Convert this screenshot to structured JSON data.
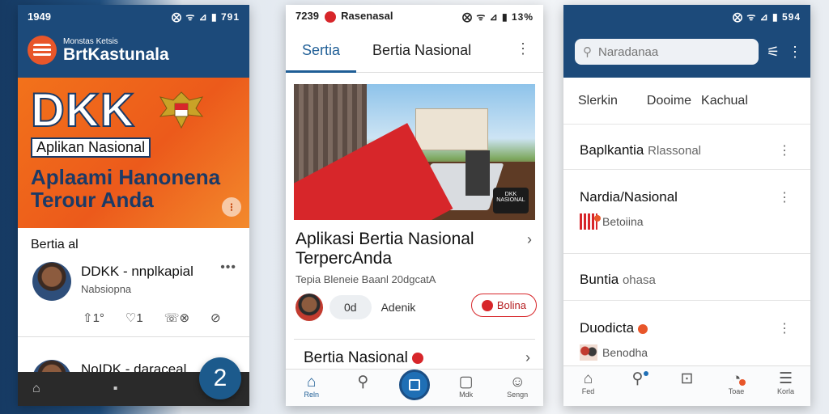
{
  "phone1": {
    "status": {
      "time": "1949",
      "icons": "⨂ ᯤ ⊿ ▮ 791"
    },
    "brand": {
      "small": "Monstas Ketsis",
      "name": "BrtKastunala"
    },
    "hero": {
      "logo_text": "DKK",
      "tagline": "Aplikan Nasional",
      "headline_1": "Aplaami Hanonena",
      "headline_2": "Terour Anda",
      "info_icon": "info-icon"
    },
    "section_title": "Bertia al",
    "post": {
      "title": "DDKK - nnplkapial",
      "subtitle": "Nabsiopna",
      "more": "•••",
      "actions": {
        "like": "⇧1°",
        "comment": "♡1",
        "share": "☏⊗",
        "reply": "⊘"
      }
    },
    "post2": {
      "title": "NoIDK - daraceal"
    },
    "fab_label": "2"
  },
  "phone2": {
    "status": {
      "time": "7239",
      "app": "Rasenasal",
      "icons": "⨂ ᯤ ⊿ ▮ 13%"
    },
    "tabs": [
      {
        "label": "Sertia"
      },
      {
        "label": "Bertia Nasional"
      }
    ],
    "image_badge": "DKK NASIONAL",
    "headline": "Aplikasi Bertia Nasional TerpercAnda",
    "meta": "Tepia Bleneie Baanl 20dgcatA",
    "actions": {
      "count": "0d",
      "author": "Adenik",
      "button": "Bolina"
    },
    "headline2": "Bertia Nasional",
    "nav": [
      {
        "label": "Reln",
        "icon": "home-icon"
      },
      {
        "label": "",
        "icon": "search-icon"
      },
      {
        "label": "",
        "icon": "square-icon"
      },
      {
        "label": "Mdk",
        "icon": "chat-icon"
      },
      {
        "label": "Sengn",
        "icon": "profile-icon"
      }
    ]
  },
  "phone3": {
    "status": {
      "icons": "⨂ ᯤ ⊿ ▮ 594"
    },
    "search": {
      "placeholder": "Naradanaa"
    },
    "categories": [
      "Slerkin",
      "Dooime",
      "Kachual"
    ],
    "items": [
      {
        "title": "Baplkantia",
        "tag": "Rlassonal",
        "sub": ""
      },
      {
        "title": "Nardia/Nasional",
        "tag": "",
        "sub": "Betoiina"
      },
      {
        "title": "Buntia",
        "tag": "ohasa",
        "sub": ""
      },
      {
        "title": "Duodicta",
        "tag": "",
        "sub": "Benodha"
      }
    ],
    "nav": [
      {
        "label": "Fed",
        "icon": "home-icon"
      },
      {
        "label": "",
        "icon": "search-icon"
      },
      {
        "label": "",
        "icon": "square-icon"
      },
      {
        "label": "Toae",
        "icon": "chat-icon"
      },
      {
        "label": "Korla",
        "icon": "menu-icon"
      }
    ]
  },
  "colors": {
    "primary": "#1c4a7a",
    "accent": "#ec5a1b",
    "red": "#d7262a"
  }
}
